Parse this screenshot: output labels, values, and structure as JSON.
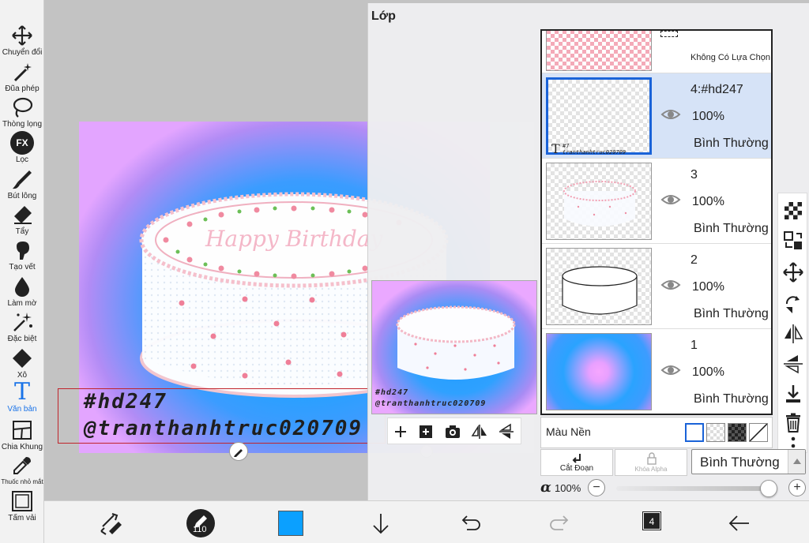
{
  "toolbar": {
    "tools": [
      {
        "label": "Chuyển đổi",
        "icon": "move-icon"
      },
      {
        "label": "Đũa phép",
        "icon": "magic-wand-icon"
      },
      {
        "label": "Thòng lọng",
        "icon": "lasso-icon"
      },
      {
        "label": "Lọc",
        "icon": "fx-icon",
        "glyph": "FX"
      },
      {
        "label": "Bút lông",
        "icon": "brush-icon"
      },
      {
        "label": "Tẩy",
        "icon": "eraser-icon"
      },
      {
        "label": "Tạo vết",
        "icon": "smudge-icon"
      },
      {
        "label": "Làm mờ",
        "icon": "blur-icon"
      },
      {
        "label": "Đặc biệt",
        "icon": "sparkle-icon"
      },
      {
        "label": "Xô",
        "icon": "bucket-icon"
      },
      {
        "label": "Văn bản",
        "icon": "text-icon",
        "glyph": "T"
      },
      {
        "label": "Chia Khung",
        "icon": "frame-divider-icon"
      },
      {
        "label": "Thuốc nhỏ mắt",
        "icon": "eyedropper-icon"
      },
      {
        "label": "Tấm vải",
        "icon": "canvas-icon"
      }
    ]
  },
  "canvas": {
    "watermark_line1": "#hd247",
    "watermark_line2": "@tranthanhtruc020709",
    "cake_text": "Happy Birthday"
  },
  "layer_panel": {
    "title": "Lớp",
    "preview": {
      "watermark_line1": "#hd247",
      "watermark_line2": "@tranthanhtruc020709"
    },
    "selection_layer_label": "Không Có Lựa Chọn",
    "layers": [
      {
        "name": "4:#hd247",
        "opacity": "100%",
        "blend": "Bình Thường",
        "selected": true,
        "thumb_text_1": "#7",
        "thumb_text_2": "tranthanhtruc020709"
      },
      {
        "name": "3",
        "opacity": "100%",
        "blend": "Bình Thường",
        "selected": false
      },
      {
        "name": "2",
        "opacity": "100%",
        "blend": "Bình Thường",
        "selected": false
      },
      {
        "name": "1",
        "opacity": "100%",
        "blend": "Bình Thường",
        "selected": false
      }
    ],
    "background_label": "Màu Nền",
    "cut_label": "Cắt Đoạn",
    "alpha_lock_label": "Khóa Alpha",
    "blend_mode": "Bình Thường",
    "alpha_symbol": "α",
    "alpha_value": "100%",
    "minus": "−",
    "plus": "+"
  },
  "bottom_bar": {
    "brush_size": "110",
    "layer_count": "4",
    "color": "#0ba0ff"
  },
  "colors": {
    "accent": "#1a73e8",
    "selected_layer_bg": "#d6e3f7",
    "selection_border": "#c0242b"
  }
}
